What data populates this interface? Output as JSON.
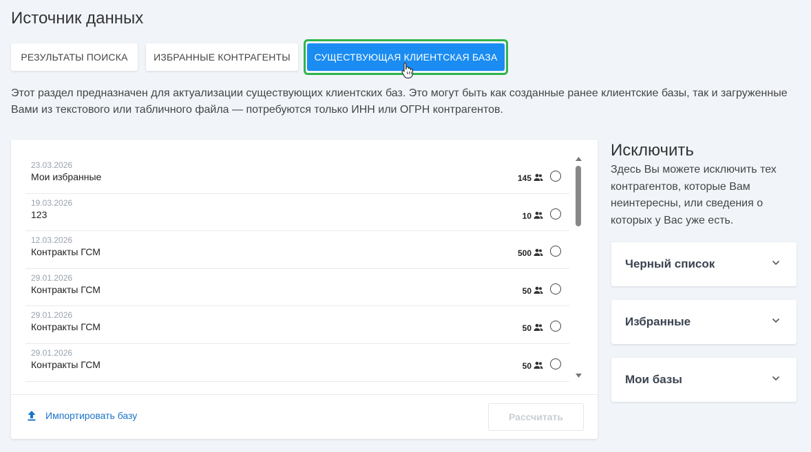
{
  "page": {
    "title": "Источник данных",
    "description": "Этот раздел предназначен для актуализации существующих клиентских баз. Это могут быть как созданные ранее клиентские базы, так и загруженные Вами из текстового или табличного файла — потребуются только ИНН или ОГРН контрагентов."
  },
  "tabs": [
    {
      "label": "РЕЗУЛЬТАТЫ ПОИСКА",
      "active": false
    },
    {
      "label": "ИЗБРАННЫЕ КОНТРАГЕНТЫ",
      "active": false
    },
    {
      "label": "СУЩЕСТВУЮЩАЯ КЛИЕНТСКАЯ БАЗА",
      "active": true
    }
  ],
  "bases": [
    {
      "date": "23.03.2026",
      "name": "Мои избранные",
      "count": "145"
    },
    {
      "date": "19.03.2026",
      "name": "123",
      "count": "10"
    },
    {
      "date": "12.03.2026",
      "name": "Контракты ГСМ",
      "count": "500"
    },
    {
      "date": "29.01.2026",
      "name": "Контракты ГСМ",
      "count": "50"
    },
    {
      "date": "29.01.2026",
      "name": "Контракты ГСМ",
      "count": "50"
    },
    {
      "date": "29.01.2026",
      "name": "Контракты ГСМ",
      "count": "50"
    }
  ],
  "actions": {
    "import_label": "Импортировать базу",
    "calculate_label": "Рассчитать"
  },
  "exclude": {
    "title": "Исключить",
    "text": "Здесь Вы можете исключить тех контрагентов, которые Вам неинтересны, или сведения о которых у Вас уже есть.",
    "sections": [
      "Черный список",
      "Избранные",
      "Мои базы"
    ]
  },
  "colors": {
    "accent": "#1a8cf2",
    "highlight_ring": "#2fb54a",
    "link": "#1a73c9",
    "background": "#f1f5fa"
  }
}
